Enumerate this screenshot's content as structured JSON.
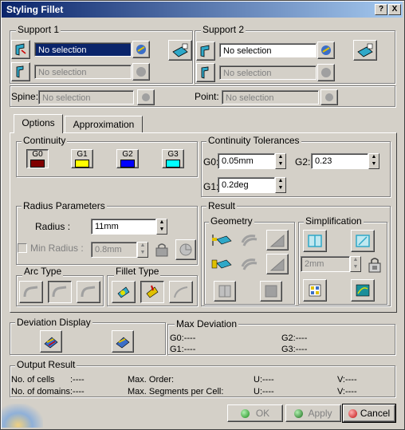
{
  "window": {
    "title": "Styling Fillet",
    "help_label": "?",
    "close_label": "X"
  },
  "support1": {
    "label": "Support 1",
    "field1": "No selection",
    "field2": "No selection"
  },
  "support2": {
    "label": "Support 2",
    "field1": "No selection",
    "field2": "No selection"
  },
  "spine": {
    "label": "Spine:",
    "value": "No selection"
  },
  "point": {
    "label": "Point:",
    "value": "No selection"
  },
  "tabs": [
    {
      "label": "Options"
    },
    {
      "label": "Approximation"
    }
  ],
  "continuity": {
    "label": "Continuity",
    "buttons": [
      {
        "label": "G0",
        "color": "#800000"
      },
      {
        "label": "G1",
        "color": "#ffff00"
      },
      {
        "label": "G2",
        "color": "#0000ff"
      },
      {
        "label": "G3",
        "color": "#00ffff"
      }
    ]
  },
  "tolerances": {
    "label": "Continuity Tolerances",
    "g0_label": "G0:",
    "g0": "0.05mm",
    "g1_label": "G1:",
    "g1": "0.2deg",
    "g2_label": "G2:",
    "g2": "0.23"
  },
  "radius": {
    "label": "Radius Parameters",
    "radius_label": "Radius :",
    "radius": "11mm",
    "min_label": "Min Radius :",
    "min": "0.8mm"
  },
  "result": {
    "label": "Result",
    "geometry_label": "Geometry",
    "simplification_label": "Simplification",
    "simp_value": "2mm"
  },
  "arc_type": {
    "label": "Arc Type"
  },
  "fillet_type": {
    "label": "Fillet Type"
  },
  "deviation": {
    "label": "Deviation Display"
  },
  "max_deviation": {
    "label": "Max Deviation",
    "g0": "G0:----",
    "g1": "G1:----",
    "g2": "G2:----",
    "g3": "G3:----"
  },
  "output": {
    "label": "Output Result",
    "cells": "No. of cells",
    ":cells_val": ":----",
    "domains": "No. of domains:----",
    "max_order": "Max. Order:",
    "max_segments": "Max. Segments per Cell:",
    "u1": "U:----",
    "u2": "U:----",
    "v1": "V:----",
    "v2": "V:----",
    "cells_val": ":----"
  },
  "footer": {
    "ok": "OK",
    "apply": "Apply",
    "cancel": "Cancel"
  }
}
